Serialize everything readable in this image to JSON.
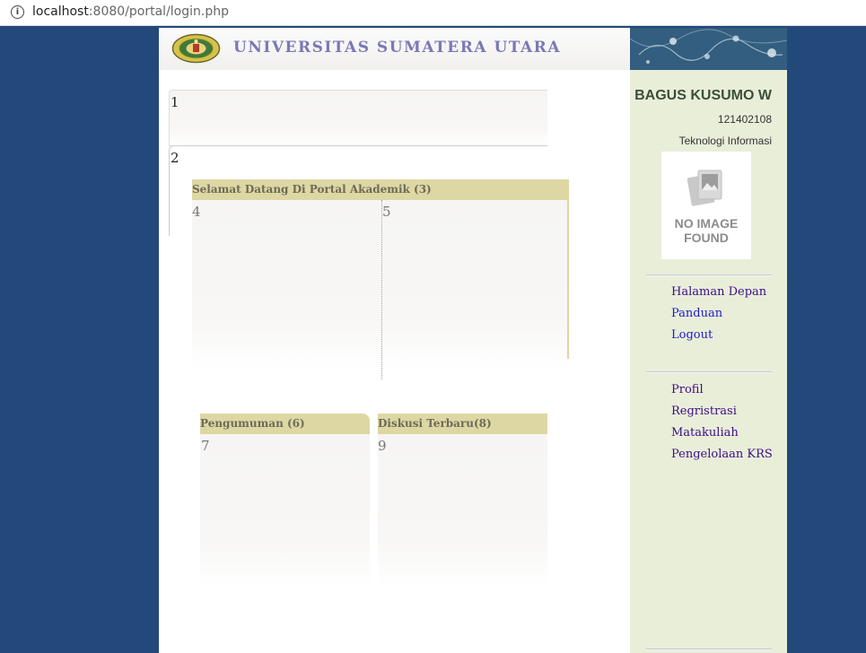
{
  "browser": {
    "url_host": "localhost",
    "url_path": ":8080/portal/login.php"
  },
  "header": {
    "university_name": "UNIVERSITAS SUMATERA UTARA"
  },
  "content": {
    "panel1_number": "1",
    "panel2_number": "2",
    "welcome": {
      "title": "Selamat Datang Di Portal Akademik (3)",
      "left_number": "4",
      "right_number": "5"
    },
    "announcements": {
      "title": "Pengumuman (6)",
      "number": "7"
    },
    "discussion": {
      "title": "Diskusi Terbaru(8)",
      "number": "9"
    }
  },
  "sidebar": {
    "user_name": "BAGUS KUSUMO W",
    "user_nim": "121402108",
    "user_program": "Teknologi Informasi",
    "avatar_text_line1": "NO IMAGE",
    "avatar_text_line2": "FOUND",
    "nav_main": [
      {
        "label": "Halaman Depan"
      },
      {
        "label": "Panduan"
      },
      {
        "label": "Logout"
      }
    ],
    "nav_academic": [
      {
        "label": "Profil"
      },
      {
        "label": "Regristrasi"
      },
      {
        "label": "Matakuliah"
      },
      {
        "label": "Pengelolaan KRS"
      }
    ]
  },
  "colors": {
    "background": "#23487a",
    "panel_header": "#ddd7a3",
    "sidebar": "#e9eed9",
    "link_visited": "#3a0e87",
    "link": "#1c1ad0"
  }
}
